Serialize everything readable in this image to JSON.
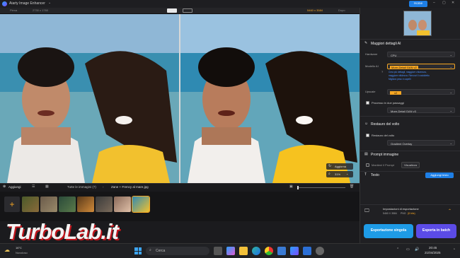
{
  "app": {
    "title": "Aiarty Image Enhancer",
    "home_label": "Home"
  },
  "subbar": {
    "left_label": "Piena",
    "left_size": "2730 x 1760",
    "right_size": "5460 x 3584",
    "right_label": "Dopo"
  },
  "viewer": {
    "update_label": "Aggiorna",
    "zoom": "31%"
  },
  "bottombar": {
    "add_label": "Aggiungi",
    "all_images": "Tutte le immagini (7)",
    "file_name": "Zane + Frency al mare.jpg"
  },
  "sidebar": {
    "details_title": "Maggiori dettagli AI",
    "hardware_label": "Hardware",
    "hardware_value": "CPU",
    "model_label": "Modello AI",
    "model_value": "More-Detail GAN v2",
    "model_desc": [
      "Crea più dettagli, maggiore chiarezza,",
      "maggiore nitidezza. Rimuovi il cosiddetto",
      "Migliora peso e capelli"
    ],
    "scale_label": "Upscale",
    "scale_value": "x2",
    "two_pass_label": "Processo in due passaggi",
    "two_pass_value": "More-Detail GAN v3",
    "face_title": "Restauro del volto",
    "face_check_label": "Restauro del volto",
    "face_value": "Gradient Overlay",
    "prompt_title": "Prompt immagine",
    "prompt_check_label": "Mantieni il Prompt",
    "prompt_view": "Visualizza",
    "text_title": "Testo",
    "add_text_button": "Aggiungi testo",
    "export_title": "Impostazioni di esportazione",
    "export_size": "5460 X 3584",
    "export_format": "PNG",
    "export_bits": "(8 bits)",
    "export_single": "Esportazione singola",
    "export_batch": "Esporta in batch"
  },
  "watermark": {
    "text": "TurboLab.it"
  },
  "taskbar": {
    "temp": "16°C",
    "weather": "Nuvoloso",
    "search": "Cerca",
    "time": "20:45",
    "date": "21/04/2025"
  },
  "colors": {
    "accent": "#1e7fe6",
    "orange": "#f5a623",
    "export_single": "#1e9be6",
    "export_batch": "#5b4be6"
  }
}
